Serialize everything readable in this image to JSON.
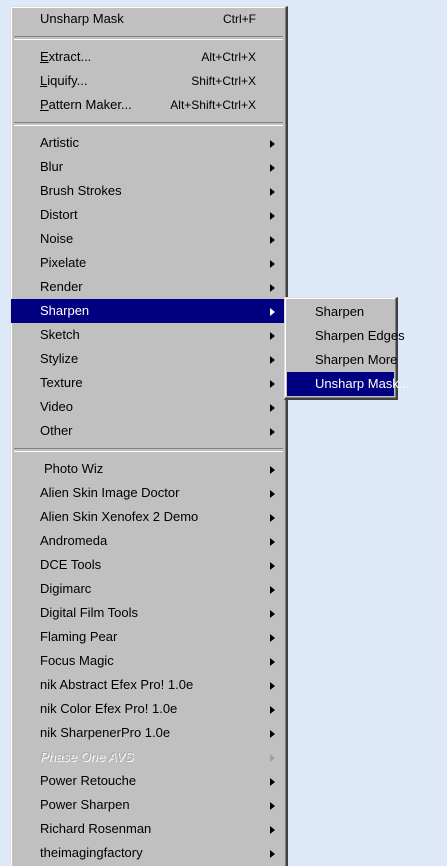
{
  "menu": {
    "top": [
      {
        "label": "Unsharp Mask",
        "shortcut": "Ctrl+F"
      }
    ],
    "extras": [
      {
        "first": "E",
        "rest": "xtract...",
        "shortcut": "Alt+Ctrl+X"
      },
      {
        "first": "L",
        "rest": "iquify...",
        "shortcut": "Shift+Ctrl+X"
      },
      {
        "first": "P",
        "rest": "attern Maker...",
        "shortcut": "Alt+Shift+Ctrl+X"
      }
    ],
    "filters": [
      "Artistic",
      "Blur",
      "Brush Strokes",
      "Distort",
      "Noise",
      "Pixelate",
      "Render",
      "Sharpen",
      "Sketch",
      "Stylize",
      "Texture",
      "Video",
      "Other"
    ],
    "plugins": [
      "Photo Wiz",
      "Alien Skin Image Doctor",
      "Alien Skin Xenofex 2 Demo",
      "Andromeda",
      "DCE Tools",
      "Digimarc",
      "Digital Film Tools",
      "Flaming Pear",
      "Focus Magic",
      "nik Abstract Efex Pro! 1.0e",
      "nik Color Efex Pro! 1.0e",
      "nik SharpenerPro 1.0e",
      "Phase One AVS",
      "Power Retouche",
      "Power Sharpen",
      "Richard Rosenman",
      "theimagingfactory"
    ]
  },
  "submenu": {
    "items": [
      "Sharpen",
      "Sharpen Edges",
      "Sharpen More",
      "Unsharp Mask..."
    ]
  }
}
